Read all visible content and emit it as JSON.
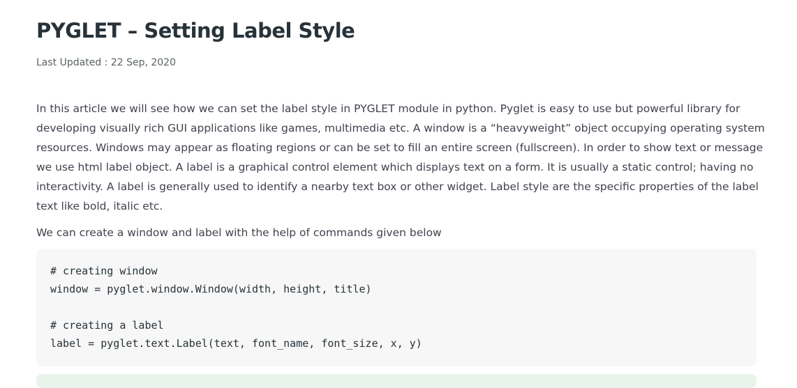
{
  "article": {
    "title": "PYGLET – Setting Label Style",
    "last_updated": "Last Updated : 22 Sep, 2020",
    "intro_lines": [
      "In this article we will see how we can set the label style in PYGLET module in python. Pyglet is easy to use but powerful library for",
      "developing visually rich GUI applications like games, multimedia etc. A window is a “heavyweight” object occupying operating system",
      "resources. Windows may appear as floating regions or can be set to fill an entire screen (fullscreen). In order to show text or message",
      "we use html label object. A label is a graphical control element which displays text on a form. It is usually a static control; having no",
      "interactivity. A label is generally used to identify a nearby text box or other widget. Label style are the specific properties of the label",
      "text like bold, italic etc."
    ],
    "commands_intro": "We can create a window and label with the help of commands given below",
    "code_lines": [
      "# creating window",
      "window = pyglet.window.Window(width, height, title)",
      "",
      "# creating a label",
      "label = pyglet.text.Label(text, font_name, font_size, x, y)"
    ]
  },
  "colors": {
    "title": "#273239",
    "body_text": "#40424e",
    "meta_text": "#5a6166",
    "code_background": "#f7f7f7",
    "next_block_background": "#e8f4ea"
  }
}
